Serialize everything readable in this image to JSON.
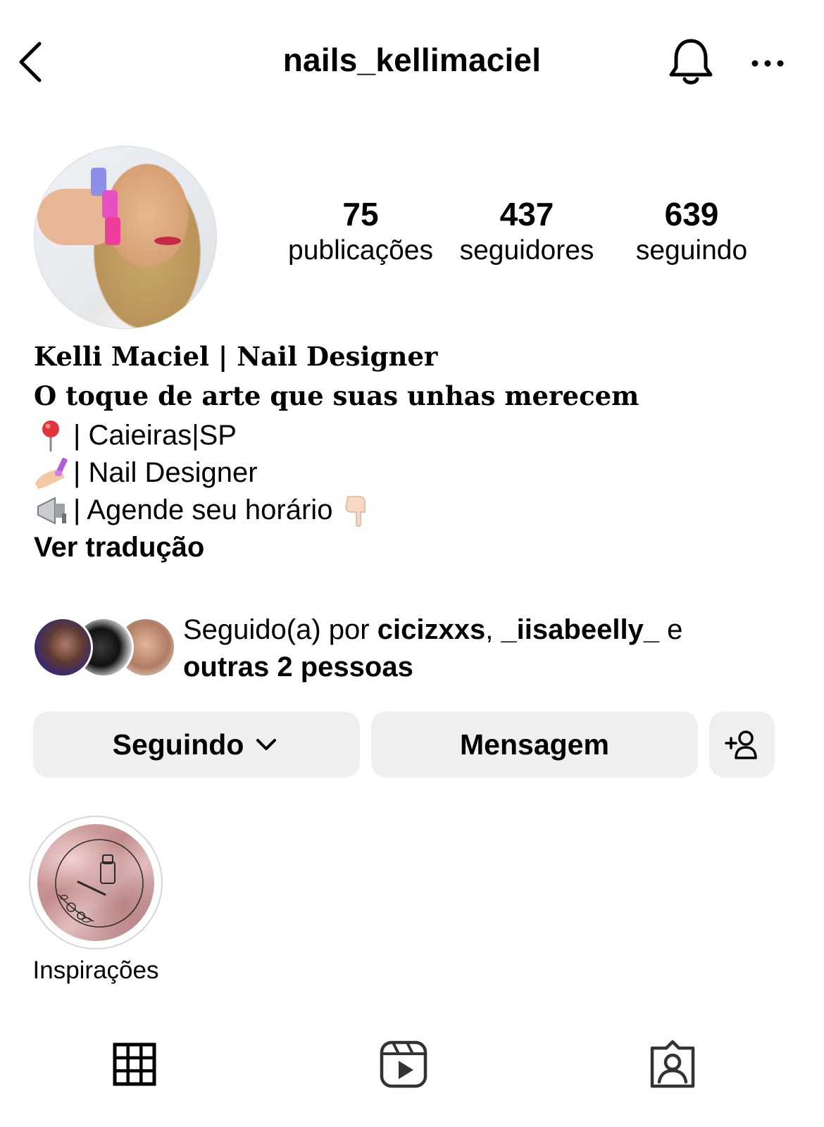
{
  "header": {
    "username": "nails_kellimaciel"
  },
  "profile": {
    "avatar_icon": "profile-photo",
    "stats": [
      {
        "count": "75",
        "label": "publicações"
      },
      {
        "count": "437",
        "label": "seguidores"
      },
      {
        "count": "639",
        "label": "seguindo"
      }
    ]
  },
  "bio": {
    "name": "Kelli Maciel | Nail Designer",
    "tagline": "O toque de arte que suas unhas merecem",
    "lines": [
      {
        "emoji_icon": "round-pushpin-icon",
        "text": "| Caieiras|SP"
      },
      {
        "emoji_icon": "nail-polish-icon",
        "text": "| Nail Designer"
      },
      {
        "emoji_icon": "loudspeaker-icon",
        "text": "| Agende seu horário",
        "trailing_icon": "pointing-down-icon"
      }
    ],
    "translate_label": "Ver tradução"
  },
  "followed_by": {
    "prefix": "Seguido(a) por ",
    "user1": "cicizxxs",
    "sep": ", ",
    "user2": "_iisabeelly_",
    "conj": " e",
    "others": "outras 2 pessoas"
  },
  "actions": {
    "following_label": "Seguindo",
    "message_label": "Mensagem",
    "add_icon": "add-person-icon"
  },
  "highlights": [
    {
      "label": "Inspirações"
    }
  ],
  "tabs": [
    {
      "icon": "grid-icon"
    },
    {
      "icon": "reels-icon"
    },
    {
      "icon": "tagged-icon"
    }
  ],
  "colors": {
    "button_bg": "#efefef",
    "text": "#000000",
    "background": "#ffffff"
  }
}
